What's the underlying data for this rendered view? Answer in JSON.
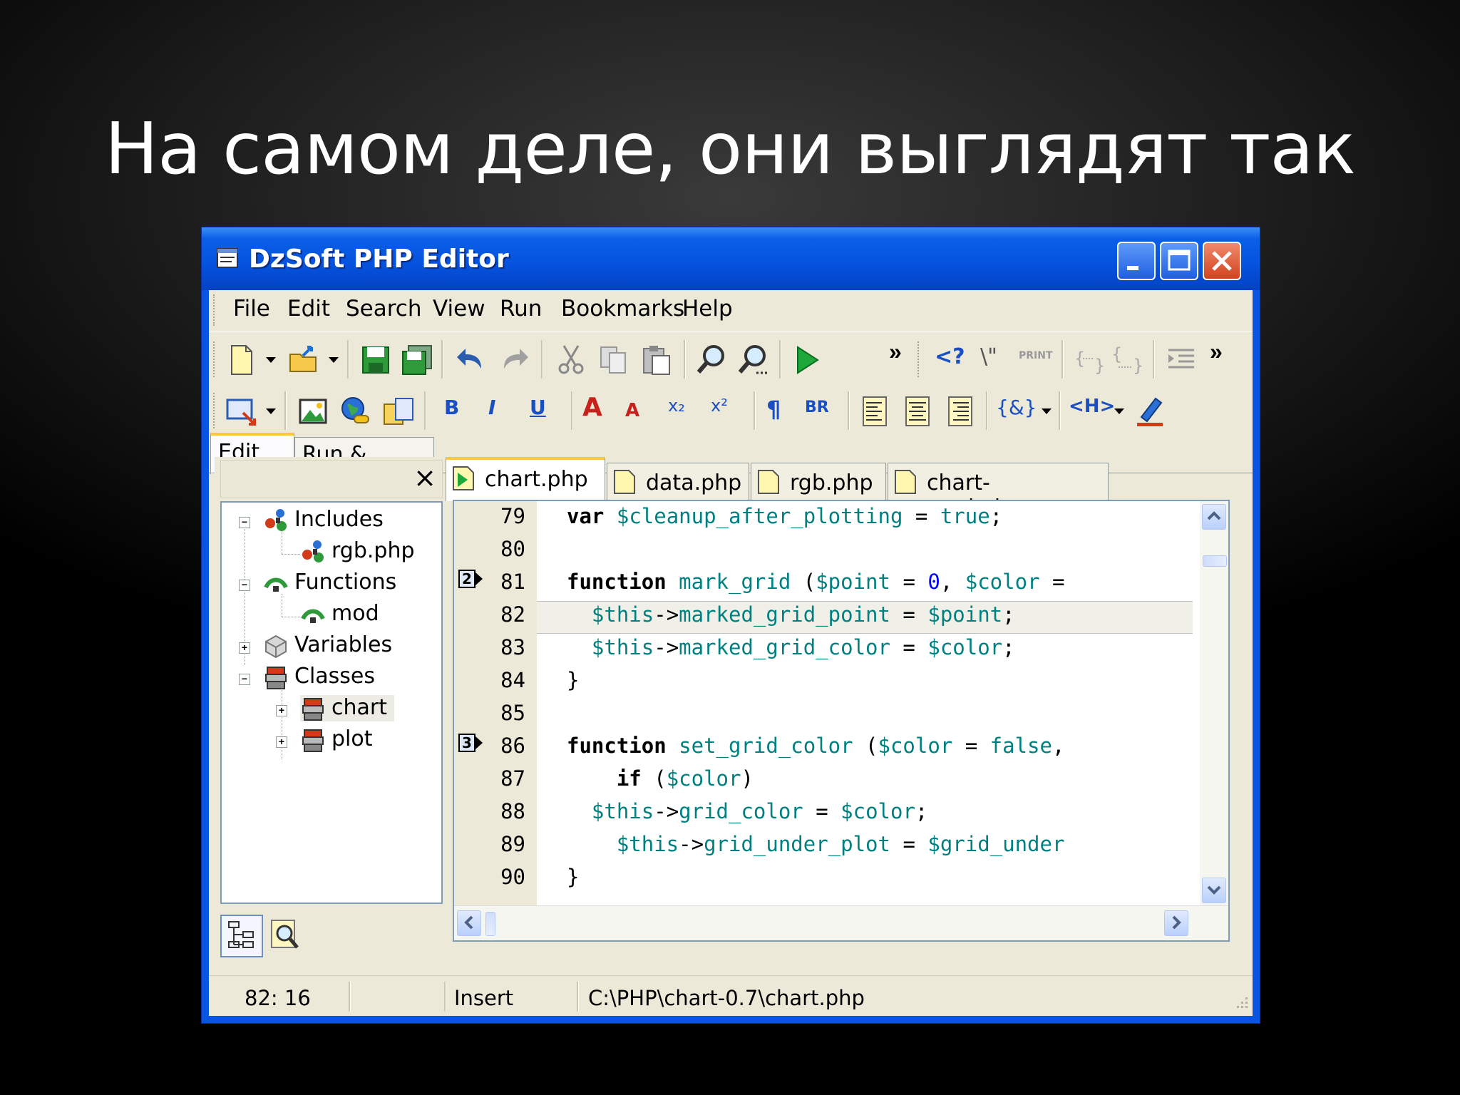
{
  "slide": {
    "title": "На самом деле, они выглядят так"
  },
  "window": {
    "title": "DzSoft PHP Editor"
  },
  "menu": [
    "File",
    "Edit",
    "Search",
    "View",
    "Run",
    "Bookmarks",
    "Help"
  ],
  "toolbar1": {
    "php_open_tag": "<?",
    "escape": "\\\"",
    "print": "PRINT"
  },
  "toolbar2": {
    "bold": "B",
    "italic": "I",
    "underline": "U",
    "font_bigger": "A",
    "font_smaller": "A",
    "subscript": "x₂",
    "superscript": "x²",
    "paragraph": "¶",
    "line_break": "BR",
    "entity": "{&}",
    "heading": "<H>"
  },
  "mode_tabs": [
    "Edit",
    "Run & Preview"
  ],
  "left_panel": {
    "close": "×"
  },
  "tree": [
    "Includes",
    "rgb.php",
    "Functions",
    "mod",
    "Variables",
    "Classes",
    "chart",
    "plot"
  ],
  "file_tabs": [
    "chart.php",
    "data.php",
    "rgb.php",
    "chart-manual.php"
  ],
  "line_numbers": [
    "79",
    "80",
    "81",
    "82",
    "83",
    "84",
    "85",
    "86",
    "87",
    "88",
    "89",
    "90"
  ],
  "bookmarks": [
    "2",
    "3"
  ],
  "code": {
    "l79": [
      "var",
      " ",
      "$cleanup_after_plotting",
      " = ",
      "true",
      ";"
    ],
    "l81": [
      "function",
      " ",
      "mark_grid",
      " (",
      "$point",
      " = ",
      "0",
      ", ",
      "$color",
      " ="
    ],
    "l82": [
      "  ",
      "$this",
      "->",
      "marked_grid_point",
      " = ",
      "$point",
      ";"
    ],
    "l83": [
      "  ",
      "$this",
      "->",
      "marked_grid_color",
      " = ",
      "$color",
      ";"
    ],
    "l84": "}",
    "l86": [
      "function",
      " ",
      "set_grid_color",
      " (",
      "$color",
      " = ",
      "false",
      ","
    ],
    "l87": [
      "    ",
      "if",
      " (",
      "$color",
      ")"
    ],
    "l88": [
      "  ",
      "$this",
      "->",
      "grid_color",
      " = ",
      "$color",
      ";"
    ],
    "l89": [
      "    ",
      "$this",
      "->",
      "grid_under_plot",
      " = ",
      "$grid_under"
    ],
    "l90": "}"
  },
  "status": {
    "position": "82: 16",
    "mode": "Insert",
    "path": "C:\\PHP\\chart-0.7\\chart.php"
  }
}
